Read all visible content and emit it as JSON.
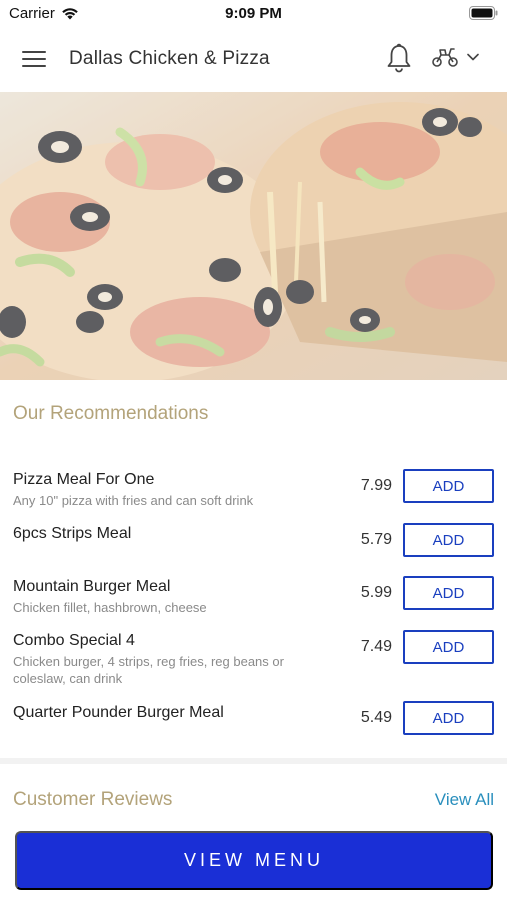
{
  "status_bar": {
    "carrier": "Carrier",
    "time": "9:09 PM"
  },
  "header": {
    "title": "Dallas Chicken & Pizza"
  },
  "icons": [
    "hamburger-menu-icon",
    "bell-icon",
    "scooter-delivery-icon",
    "chevron-down-icon",
    "wifi-icon",
    "battery-icon"
  ],
  "recommendations": {
    "heading": "Our Recommendations",
    "items": [
      {
        "name": "Pizza Meal For One",
        "description": "Any 10\" pizza with fries and can soft drink",
        "price": "7.99",
        "add_label": "ADD"
      },
      {
        "name": "6pcs Strips Meal",
        "description": "",
        "price": "5.79",
        "add_label": "ADD"
      },
      {
        "name": "Mountain Burger Meal",
        "description": "Chicken fillet, hashbrown, cheese",
        "price": "5.99",
        "add_label": "ADD"
      },
      {
        "name": "Combo Special 4",
        "description": "Chicken burger, 4 strips, reg fries, reg beans or coleslaw, can drink",
        "price": "7.49",
        "add_label": "ADD"
      },
      {
        "name": "Quarter Pounder Burger Meal",
        "description": "",
        "price": "5.49",
        "add_label": "ADD"
      }
    ]
  },
  "reviews": {
    "heading": "Customer Reviews",
    "view_all": "View All"
  },
  "cta": {
    "view_menu": "VIEW MENU"
  },
  "colors": {
    "accent_blue": "#1a2fd6",
    "heading_gold": "#b3a37a",
    "link_blue": "#2a8fbd"
  }
}
